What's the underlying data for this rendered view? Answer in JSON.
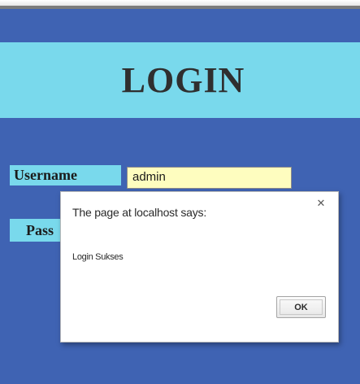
{
  "page": {
    "title": "LOGIN"
  },
  "form": {
    "username_label": "Username",
    "username_value": "admin",
    "password_label": "Pass"
  },
  "dialog": {
    "header": "The page at localhost says:",
    "message": "Login Sukses",
    "ok_label": "OK",
    "close_icon": "close-icon"
  },
  "colors": {
    "page_background": "#3f63b3",
    "banner_background": "#79d9ec",
    "input_background": "#fefdbf"
  }
}
